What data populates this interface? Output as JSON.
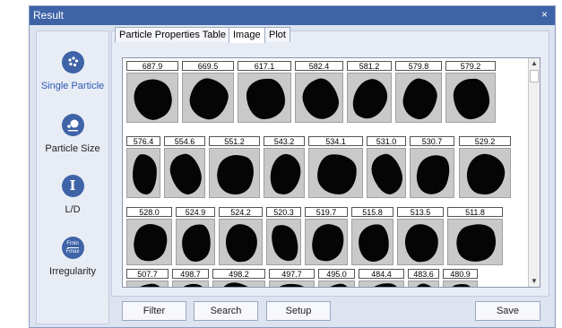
{
  "window": {
    "title": "Result",
    "close_glyph": "×",
    "accent": "#3f63a7"
  },
  "sidebar": {
    "items": [
      {
        "label": "Single Particle",
        "icon": "single-particle-icon",
        "active": true
      },
      {
        "label": "Particle Size",
        "icon": "particle-size-icon",
        "active": false
      },
      {
        "label": "L/D",
        "icon": "length-diameter-icon",
        "glyph": "I",
        "active": false
      },
      {
        "label": "Irregularity",
        "icon": "irregularity-icon",
        "glyph_top": "Fmin",
        "glyph_bottom": "Fmax",
        "active": false
      }
    ]
  },
  "tabs": [
    {
      "label": "Particle Properties Table",
      "active": false
    },
    {
      "label": "Image",
      "active": true
    },
    {
      "label": "Plot",
      "active": false
    }
  ],
  "particles": {
    "row1": [
      "687.9",
      "669.5",
      "617.1",
      "582.4",
      "581.2",
      "579.8",
      "579.2"
    ],
    "row2": [
      "576.4",
      "554.6",
      "551.2",
      "543.2",
      "534.1",
      "531.0",
      "530.7",
      "529.2"
    ],
    "row3": [
      "528.0",
      "524.9",
      "524.2",
      "520.3",
      "519.7",
      "515.8",
      "513.5",
      "511.8"
    ],
    "row4": [
      "507.7",
      "498.7",
      "498.2",
      "497.7",
      "495.0",
      "484.4",
      "483.6",
      "480.9"
    ]
  },
  "scrollbar": {
    "up_glyph": "▲",
    "down_glyph": "▼"
  },
  "buttons": {
    "filter": "Filter",
    "search": "Search",
    "setup": "Setup",
    "save": "Save"
  }
}
